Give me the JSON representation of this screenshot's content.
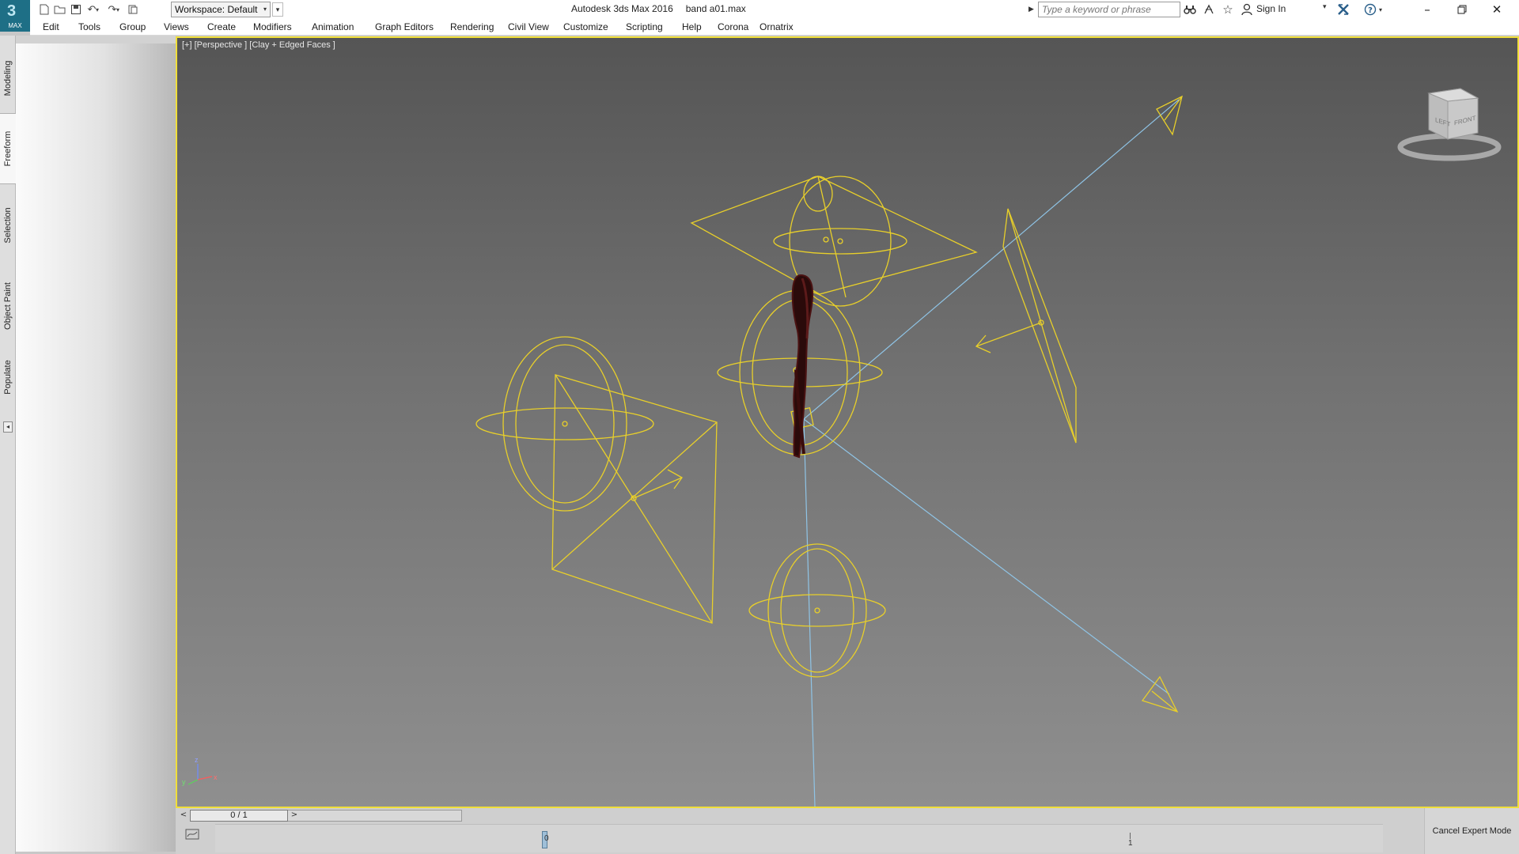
{
  "app": {
    "logo_label": "MAX",
    "workspace": "Workspace: Default",
    "app_title": "Autodesk 3ds Max 2016",
    "file_name": "band a01.max",
    "search_placeholder": "Type a keyword or phrase",
    "sign_in": "Sign In"
  },
  "quick_access_icons": [
    "new-file-icon",
    "open-file-icon",
    "save-icon",
    "undo-icon",
    "redo-icon",
    "project-folder-icon"
  ],
  "title_icons": [
    "binoculars-icon",
    "communication-center-icon",
    "favorites-star-icon",
    "user-icon",
    "exchange-x-icon",
    "help-icon"
  ],
  "window_controls": [
    "minimize",
    "restore",
    "close"
  ],
  "menu": {
    "items": [
      "Edit",
      "Tools",
      "Group",
      "Views",
      "Create",
      "Modifiers",
      "Animation",
      "Graph Editors",
      "Rendering",
      "Civil View",
      "Customize",
      "Scripting",
      "Help",
      "Corona",
      "Ornatrix"
    ]
  },
  "ribbon_tabs": {
    "items": [
      "Modeling",
      "Freeform",
      "Selection",
      "Object Paint",
      "Populate"
    ],
    "active": "Freeform"
  },
  "viewport": {
    "label": "[+] [Perspective ] [Clay + Edged Faces ]",
    "viewcube_left": "LEFT",
    "viewcube_front": "FRONT",
    "axis_x": "x",
    "axis_y": "y",
    "axis_z": "z",
    "wire_color": "#e8cf2a",
    "target_line_color": "#8fc4e6",
    "border_color": "#f0df3a"
  },
  "timeline": {
    "slider_text": "0 / 1",
    "prev": "<",
    "next": ">",
    "frame_start": "0",
    "frame_end": "1",
    "expert_button": "Cancel Expert Mode"
  }
}
